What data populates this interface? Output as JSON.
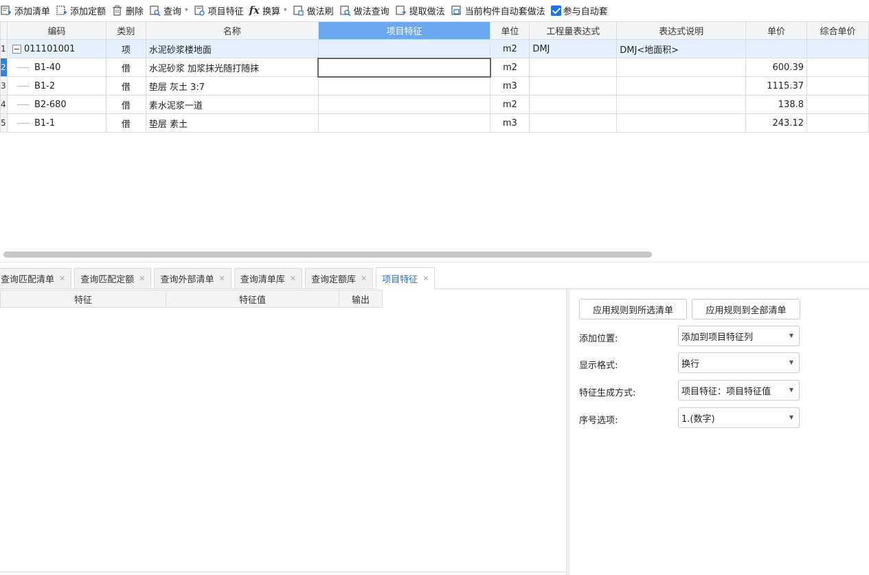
{
  "toolbar": {
    "add_list": "添加清单",
    "add_quota": "添加定额",
    "delete": "删除",
    "query": "查询",
    "item_features": "项目特征",
    "convert": "换算",
    "method_brush": "做法刷",
    "method_query": "做法查询",
    "extract_method": "提取做法",
    "auto_method": "当前构件自动套做法",
    "participate_auto": "参与自动套"
  },
  "grid": {
    "headers": [
      "编码",
      "类别",
      "名称",
      "项目特征",
      "单位",
      "工程量表达式",
      "表达式说明",
      "单价",
      "综合单价"
    ],
    "rows": [
      {
        "idx": "1",
        "code": "011101001",
        "type": "项",
        "name": "水泥砂浆楼地面",
        "feature": "",
        "unit": "m2",
        "expr": "DMJ",
        "expr_desc": "DMJ<地面积>",
        "price": "",
        "total_price": ""
      },
      {
        "idx": "2",
        "code": "B1-40",
        "type": "借",
        "name": "水泥砂浆 加浆抹光随打随抹",
        "feature": "",
        "unit": "m2",
        "expr": "",
        "expr_desc": "",
        "price": "600.39",
        "total_price": ""
      },
      {
        "idx": "3",
        "code": "B1-2",
        "type": "借",
        "name": "垫层 灰土 3:7",
        "feature": "",
        "unit": "m3",
        "expr": "",
        "expr_desc": "",
        "price": "1115.37",
        "total_price": ""
      },
      {
        "idx": "4",
        "code": "B2-680",
        "type": "借",
        "name": "素水泥浆一道",
        "feature": "",
        "unit": "m2",
        "expr": "",
        "expr_desc": "",
        "price": "138.8",
        "total_price": ""
      },
      {
        "idx": "5",
        "code": "B1-1",
        "type": "借",
        "name": "垫层 素土",
        "feature": "",
        "unit": "m3",
        "expr": "",
        "expr_desc": "",
        "price": "243.12",
        "total_price": ""
      }
    ]
  },
  "tabs": [
    {
      "label": "查询匹配清单"
    },
    {
      "label": "查询匹配定额"
    },
    {
      "label": "查询外部清单"
    },
    {
      "label": "查询清单库"
    },
    {
      "label": "查询定额库"
    },
    {
      "label": "项目特征"
    }
  ],
  "feature_grid": {
    "headers": [
      "特征",
      "特征值",
      "输出"
    ]
  },
  "rules": {
    "apply_selected": "应用规则到所选清单",
    "apply_all": "应用规则到全部清单",
    "add_position_label": "添加位置:",
    "add_position_value": "添加到项目特征列",
    "display_format_label": "显示格式:",
    "display_format_value": "换行",
    "generation_label": "特征生成方式:",
    "generation_value": "项目特征：项目特征值",
    "numbering_label": "序号选项:",
    "numbering_value": "1.(数字)"
  },
  "colors": {
    "accent": "#1a73e8",
    "active_header": "#6aa8f2",
    "selected_row": "#e4f0fd"
  }
}
